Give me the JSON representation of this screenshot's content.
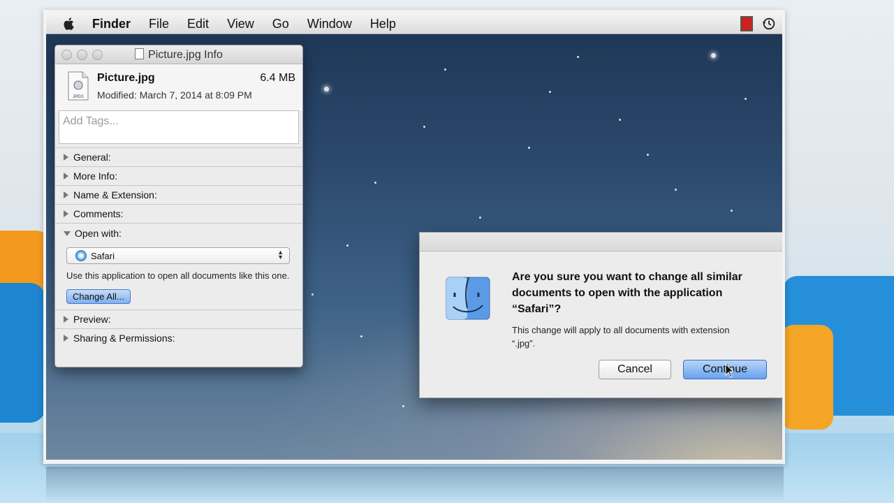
{
  "menubar": {
    "app_name": "Finder",
    "items": [
      "File",
      "Edit",
      "View",
      "Go",
      "Window",
      "Help"
    ]
  },
  "info_window": {
    "title": "Picture.jpg Info",
    "file_name": "Picture.jpg",
    "file_size": "6.4 MB",
    "modified": "Modified: March 7, 2014 at 8:09 PM",
    "file_icon_label": "JPEG",
    "tags_placeholder": "Add Tags...",
    "sections": {
      "general": "General:",
      "more_info": "More Info:",
      "name_extension": "Name & Extension:",
      "comments": "Comments:",
      "open_with": "Open with:",
      "preview": "Preview:",
      "sharing": "Sharing & Permissions:"
    },
    "open_with": {
      "selected_app": "Safari",
      "help_text": "Use this application to open all documents like this one.",
      "change_all_label": "Change All..."
    }
  },
  "alert": {
    "title": "Are you sure you want to change all similar documents to open with the application “Safari”?",
    "message": "This change will apply to all documents with extension “.jpg”.",
    "cancel_label": "Cancel",
    "continue_label": "Continue"
  },
  "colors": {
    "accent_button": "#6aa2ef",
    "record_indicator": "#d0201a"
  }
}
